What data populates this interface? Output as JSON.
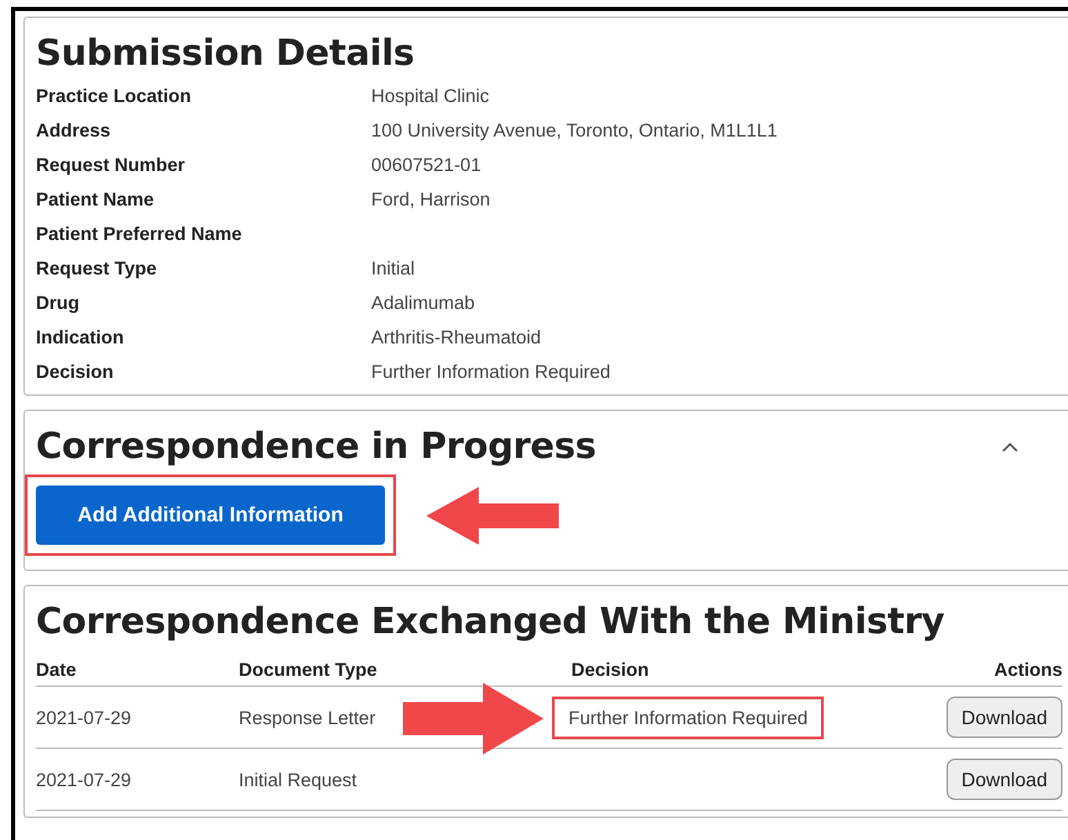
{
  "submission_details": {
    "title": "Submission Details",
    "fields": [
      {
        "label": "Practice Location",
        "value": "Hospital Clinic"
      },
      {
        "label": "Address",
        "value": "100 University Avenue, Toronto, Ontario, M1L1L1"
      },
      {
        "label": "Request Number",
        "value": "00607521-01"
      },
      {
        "label": "Patient Name",
        "value": "Ford, Harrison"
      },
      {
        "label": "Patient Preferred Name"
      },
      {
        "label": "Request Type",
        "value": "Initial"
      },
      {
        "label": "Drug",
        "value": "Adalimumab"
      },
      {
        "label": "Indication",
        "value": "Arthritis-Rheumatoid"
      },
      {
        "label": "Decision",
        "value": "Further Information Required"
      }
    ]
  },
  "correspondence_in_progress": {
    "title": "Correspondence in Progress",
    "expanded": true,
    "button": {
      "label": "Add Additional Information",
      "highlighted": true
    }
  },
  "correspondence_exchanged": {
    "title": "Correspondence Exchanged With the Ministry",
    "columns": [
      "Date",
      "Document Type",
      "Decision",
      "Actions"
    ],
    "rows": [
      {
        "date": "2021-07-29",
        "document_type": "Response Letter",
        "decision": "Further Information Required",
        "highlighted": true,
        "action": "Download"
      },
      {
        "date": "2021-07-29",
        "document_type": "Initial Request",
        "highlighted": false,
        "action": "Download"
      }
    ]
  }
}
